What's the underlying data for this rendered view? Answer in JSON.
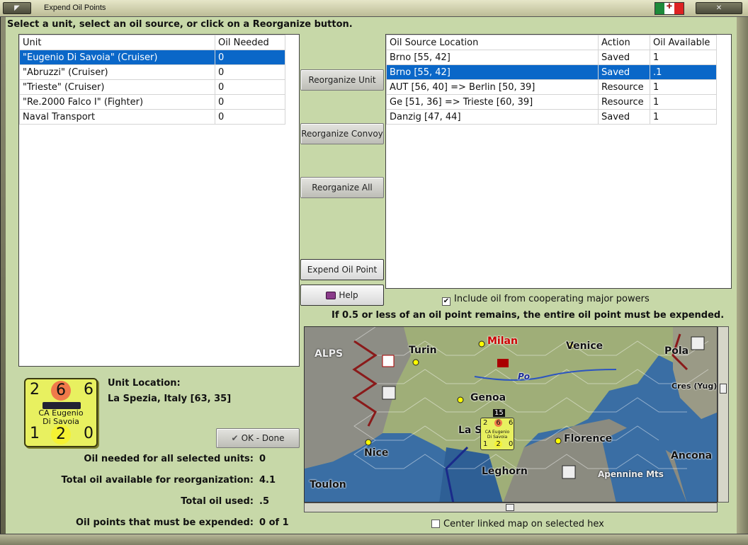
{
  "window": {
    "title": "Expend Oil Points"
  },
  "instruction": "Select a unit, select an oil source, or click on a Reorganize button.",
  "units_table": {
    "headers": [
      "Unit",
      "Oil Needed"
    ],
    "rows": [
      {
        "unit": "\"Eugenio Di Savoia\" (Cruiser)",
        "oil": "0",
        "selected": true
      },
      {
        "unit": "\"Abruzzi\" (Cruiser)",
        "oil": "0",
        "selected": false
      },
      {
        "unit": "\"Trieste\" (Cruiser)",
        "oil": "0",
        "selected": false
      },
      {
        "unit": "\"Re.2000 Falco I\" (Fighter)",
        "oil": "0",
        "selected": false
      },
      {
        "unit": "Naval Transport",
        "oil": "0",
        "selected": false
      }
    ]
  },
  "sources_table": {
    "headers": [
      "Oil Source Location",
      "Action",
      "Oil Available"
    ],
    "rows": [
      {
        "loc": "Brno [55, 42]",
        "action": "Saved",
        "avail": "1",
        "selected": false
      },
      {
        "loc": "Brno [55, 42]",
        "action": "Saved",
        "avail": ".1",
        "selected": true
      },
      {
        "loc": "AUT [56, 40] => Berlin [50, 39]",
        "action": "Resource",
        "avail": "1",
        "selected": false
      },
      {
        "loc": "Ge [51, 36] => Trieste [60, 39]",
        "action": "Resource",
        "avail": "1",
        "selected": false
      },
      {
        "loc": "Danzig [47, 44]",
        "action": "Saved",
        "avail": "1",
        "selected": false
      }
    ]
  },
  "buttons": {
    "reorganize_unit": "Reorganize Unit",
    "reorganize_convoy": "Reorganize Convoy",
    "reorganize_all": "Reorganize All",
    "expend_oil_point": "Expend Oil Point",
    "help": "Help",
    "ok_done": "OK - Done"
  },
  "include_oil_label": "Include oil from cooperating major powers",
  "include_oil_checked": true,
  "rule_note": "If 0.5 or less of an oil point remains, the entire oil point must be expended.",
  "unit_counter": {
    "top_left": "2",
    "top_mid": "6",
    "top_right": "6",
    "name_line1": "CA Eugenio",
    "name_line2": "Di Savoia",
    "bot_left": "1",
    "bot_mid": "2",
    "bot_right": "0"
  },
  "unit_location": {
    "label": "Unit Location:",
    "value": "La Spezia, Italy [63, 35]"
  },
  "stats": [
    {
      "label": "Oil needed for all selected units:",
      "value": "0"
    },
    {
      "label": "Total oil available for reorganization:",
      "value": "4.1"
    },
    {
      "label": "Total oil used:",
      "value": ".5"
    },
    {
      "label": "Oil points that must be expended:",
      "value": "0 of 1"
    }
  ],
  "map": {
    "labels": [
      "ALPS",
      "Turin",
      "Milan",
      "Venice",
      "Pola",
      "Cres (Yug)",
      "Po",
      "Genoa",
      "La S",
      "Nice",
      "Florence",
      "Ancona",
      "Leghorn",
      "Apennine Mts",
      "Toulon",
      "15"
    ],
    "mini_counter": {
      "tl": "2",
      "tm": "6",
      "tr": "6",
      "name1": "CA Eugenio",
      "name2": "Di Savoia",
      "bl": "1",
      "bm": "2",
      "br": "0"
    }
  },
  "center_map_label": "Center linked map on selected hex",
  "center_map_checked": false,
  "colors": {
    "background": "#c7d8a8",
    "selection": "#0a67c8",
    "counter": "#e8f060",
    "sea": "#3a6ea4"
  }
}
